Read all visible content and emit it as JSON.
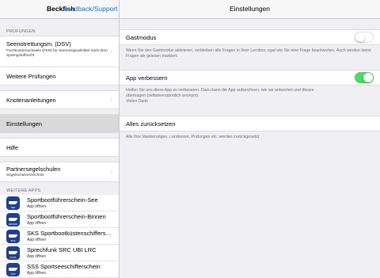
{
  "sidebar": {
    "title": "Beckfish",
    "feedback_link": "Feedback/Support",
    "section_pruefungen": "PRÜFUNGEN",
    "items": [
      {
        "title": "Seenotrettungsm. (DSV)",
        "subtitle": "Fachkundenachweis (FKN) für Seenotsignalmittel nach dem Sprengstoffrecht"
      },
      {
        "title": "Weitere Prüfungen"
      },
      {
        "title": "Knotenanleitungen"
      },
      {
        "title": "Einstellungen"
      },
      {
        "title": "Hilfe"
      },
      {
        "title": "Partnersegelschulen",
        "subtitle": "Segelschulverzeichnis"
      }
    ],
    "section_apps": "WEITERE APPS",
    "apps": [
      {
        "name": "Sportbootführerschein-See",
        "sub": "App öffnen",
        "tag": "SBF"
      },
      {
        "name": "Sportbootführerschein-Binnen",
        "sub": "App öffnen",
        "tag": "BINNEN"
      },
      {
        "name": "SKS Sportbootküstenschifferschein",
        "sub": "App öffnen",
        "tag": "SKS"
      },
      {
        "name": "Sprechfunk SRC UBI LRC",
        "sub": "App öffnen",
        "tag": "FUNK"
      },
      {
        "name": "SSS Sportseeschifferschein",
        "sub": "App öffnen",
        "tag": "SSS"
      }
    ]
  },
  "main": {
    "title": "Einstellungen",
    "gastmodus": {
      "label": "Gastmodus",
      "enabled": false,
      "footer": "Wenn Sie den Gastmodus aktivieren, verbleiben alle Fragen in Ihrer Lernbox, egal wie Sie eine Frage beantworten. Auch werden keine Fragen als gelesen markiert."
    },
    "app_verbessern": {
      "label": "App verbessern",
      "enabled": true,
      "footer_line1": "Helfen Sie uns diese App zu verbessern. Dazu kann die App aufzeichnen, wie sie antworten und dieses",
      "footer_line2": "übertragen (selbstverständlich anonym).",
      "footer_line3": "Vielen Dank"
    },
    "reset": {
      "label": "Alles zurücksetzen",
      "footer": "Alle Ihre Markierungen, Lernboxen, Prüfungen etc. werden zurückgesetzt."
    }
  },
  "colors": {
    "accent": "#007aff",
    "toggle_on": "#4cd964",
    "app_icon": "#1f3f8f",
    "selected_row": "#d9d9d9",
    "background": "#efeff4"
  }
}
